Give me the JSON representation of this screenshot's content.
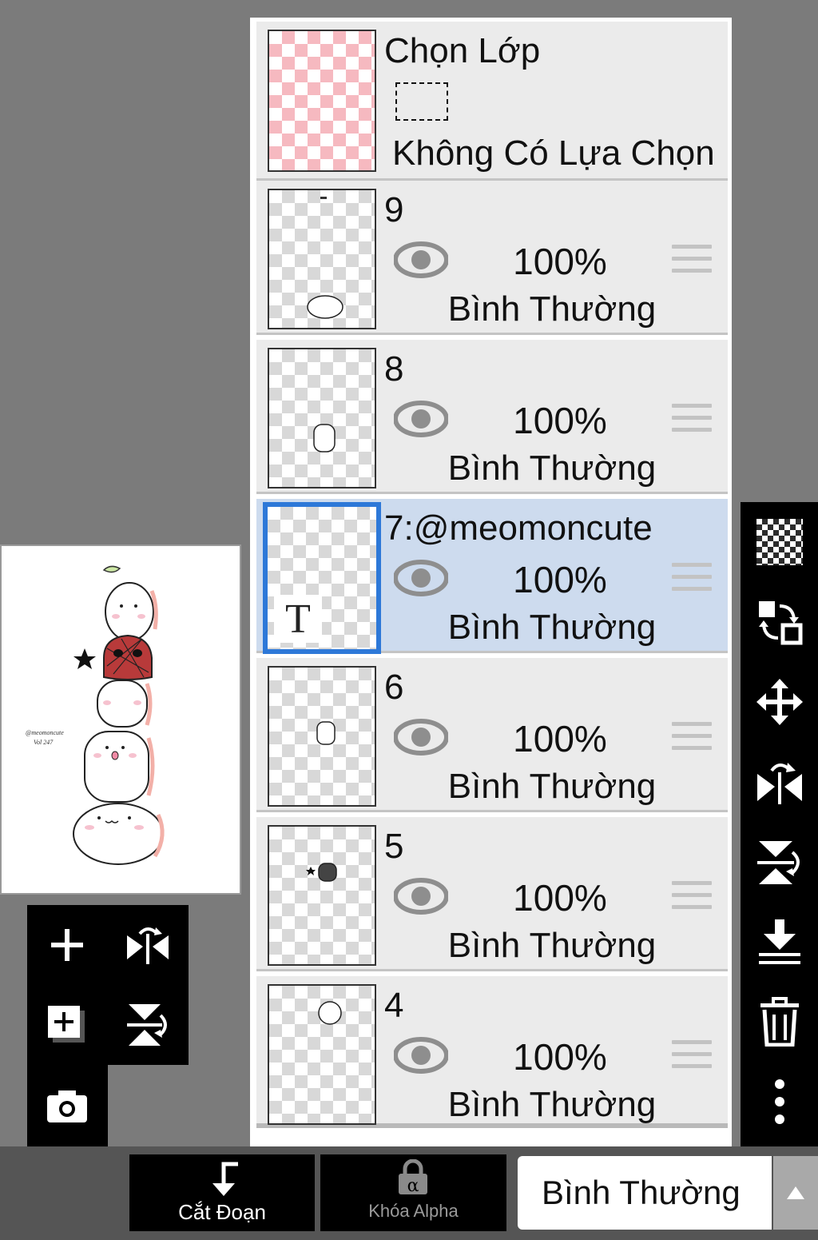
{
  "selection_layer": {
    "title": "Chọn Lớp",
    "status": "Không Có Lựa Chọn"
  },
  "layers": [
    {
      "name": "9",
      "opacity": "100%",
      "blend": "Bình Thường"
    },
    {
      "name": "8",
      "opacity": "100%",
      "blend": "Bình Thường"
    },
    {
      "name": "7:@meomoncute",
      "opacity": "100%",
      "blend": "Bình Thường",
      "selected": true,
      "badge": "T"
    },
    {
      "name": "6",
      "opacity": "100%",
      "blend": "Bình Thường"
    },
    {
      "name": "5",
      "opacity": "100%",
      "blend": "Bình Thường"
    },
    {
      "name": "4",
      "opacity": "100%",
      "blend": "Bình Thường"
    }
  ],
  "canvas": {
    "caption_line1": "@meomoncute",
    "caption_line2": "Vol 247"
  },
  "bottom_bar": {
    "clip_label": "Cắt Đoạn",
    "alpha_lock_label": "Khóa Alpha",
    "blend_mode_value": "Bình Thường"
  },
  "left_toolbar": [
    "add-layer-icon",
    "flip-horizontal-icon",
    "add-layer-copy-icon",
    "flip-vertical-icon",
    "camera-icon"
  ],
  "right_toolbar": [
    "transparent-icon",
    "swap-layers-icon",
    "move-icon",
    "flip-horizontal-icon",
    "flip-vertical-icon",
    "merge-down-icon",
    "trash-icon",
    "more-icon"
  ],
  "colors": {
    "selected_row": "#cddbee",
    "selected_border": "#2d78d8",
    "background": "#7b7b7b"
  }
}
